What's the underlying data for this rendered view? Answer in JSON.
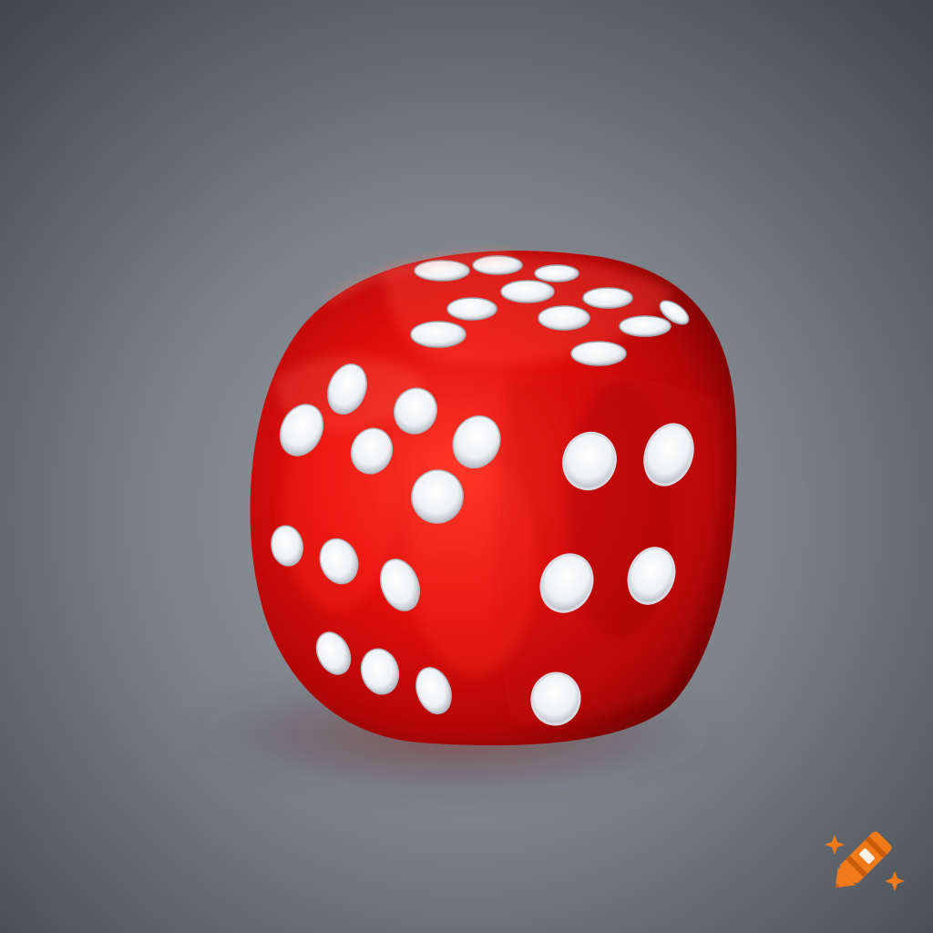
{
  "image": {
    "subject": "die-photo",
    "colors": {
      "background_top": "#4a5058",
      "background_mid": "#8f959c",
      "background_bottom": "#6e737a",
      "die_red": "#e01010",
      "die_dark": "#7a0404",
      "die_highlight": "#ff5a4a",
      "pip": "#f4f4f6",
      "watermark": "#f07a1a"
    },
    "icons": {
      "watermark": "crayon-icon",
      "sparkles": "sparkle-icon"
    }
  }
}
